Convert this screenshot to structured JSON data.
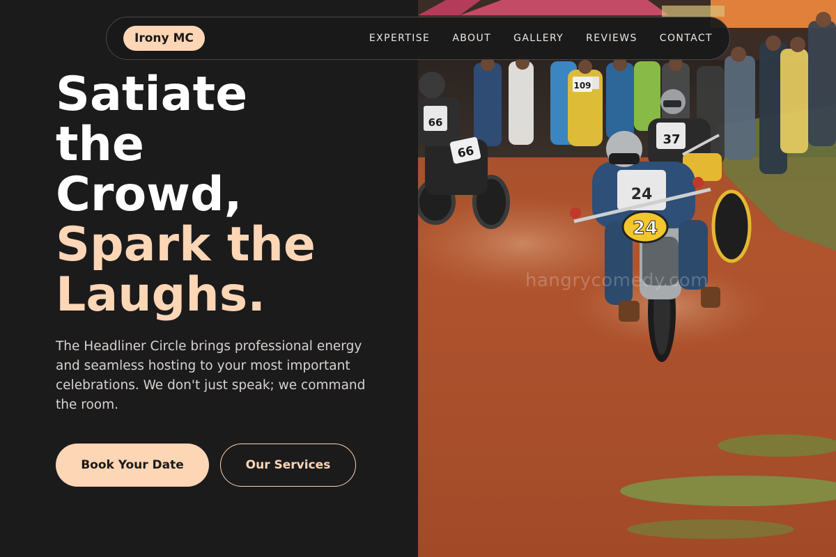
{
  "nav": {
    "brand": "Irony MC",
    "links": [
      "EXPERTISE",
      "ABOUT",
      "GALLERY",
      "REVIEWS",
      "CONTACT"
    ]
  },
  "hero": {
    "headline_lines": [
      "Satiate",
      "the",
      "Crowd,"
    ],
    "headline_accent_lines": [
      "Spark the",
      "Laughs."
    ],
    "description": "The Headliner Circle brings professional energy and seamless hosting to your most important celebrations. We don't just speak; we command the room.",
    "primary_cta": "Book Your Date",
    "secondary_cta": "Our Services"
  },
  "image": {
    "subject": "motorcycle dirt track race with crowd of spectators",
    "watermark": "hangrycomedy.com",
    "rider_numbers": [
      "24",
      "37",
      "66",
      "109"
    ]
  },
  "colors": {
    "background": "#1c1b1c",
    "accent": "#fdd6b6",
    "text": "#ffffff",
    "muted_text": "#d7d3d0"
  }
}
